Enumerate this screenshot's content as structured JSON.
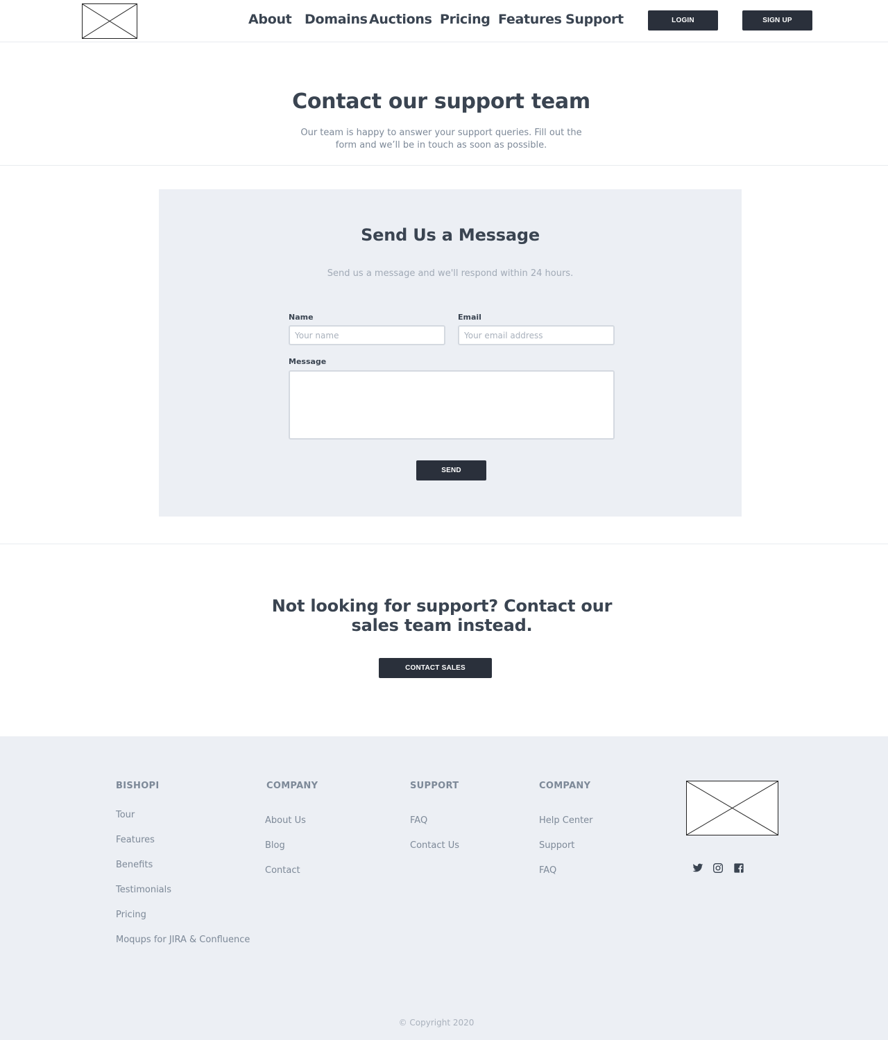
{
  "header": {
    "logo_icon": "image-placeholder-icon",
    "nav": [
      {
        "label": "About"
      },
      {
        "label": "Domains"
      },
      {
        "label": "Auctions"
      },
      {
        "label": "Pricing"
      },
      {
        "label": "Features"
      },
      {
        "label": "Support"
      }
    ],
    "login_label": "LOGIN",
    "signup_label": "SIGN UP"
  },
  "hero": {
    "title": "Contact our support team",
    "subtitle": "Our team is happy to answer your support queries. Fill out the form and we’ll be in touch as soon as possible."
  },
  "form": {
    "title": "Send Us a Message",
    "subtitle": "Send us a message and we'll respond within 24 hours.",
    "name_label": "Name",
    "name_placeholder": "Your name",
    "name_value": "",
    "email_label": "Email",
    "email_placeholder": "Your email address",
    "email_value": "",
    "message_label": "Message",
    "message_value": "",
    "send_label": "SEND"
  },
  "sales": {
    "title": "Not looking for support? Contact our sales team instead.",
    "button_label": "CONTACT SALES"
  },
  "footer": {
    "columns": [
      {
        "heading": "BISHOPI",
        "links": [
          "Tour",
          "Features",
          "Benefits",
          "Testimonials",
          "Pricing",
          "Moqups for JIRA & Confluence"
        ]
      },
      {
        "heading": "COMPANY",
        "links": [
          "About Us",
          "Blog",
          "Contact"
        ]
      },
      {
        "heading": "SUPPORT",
        "links": [
          "FAQ",
          "Contact Us"
        ]
      },
      {
        "heading": "COMPANY",
        "links": [
          "Help Center",
          "Support",
          "FAQ"
        ]
      }
    ],
    "logo_icon": "image-placeholder-icon",
    "social_icons": [
      "twitter-icon",
      "instagram-icon",
      "facebook-icon"
    ],
    "copyright": "© Copyright 2020"
  },
  "colors": {
    "text_dark": "#3a4451",
    "text_muted": "#7d8998",
    "button_dark": "#2a303b",
    "panel_bg": "#eceff4"
  }
}
